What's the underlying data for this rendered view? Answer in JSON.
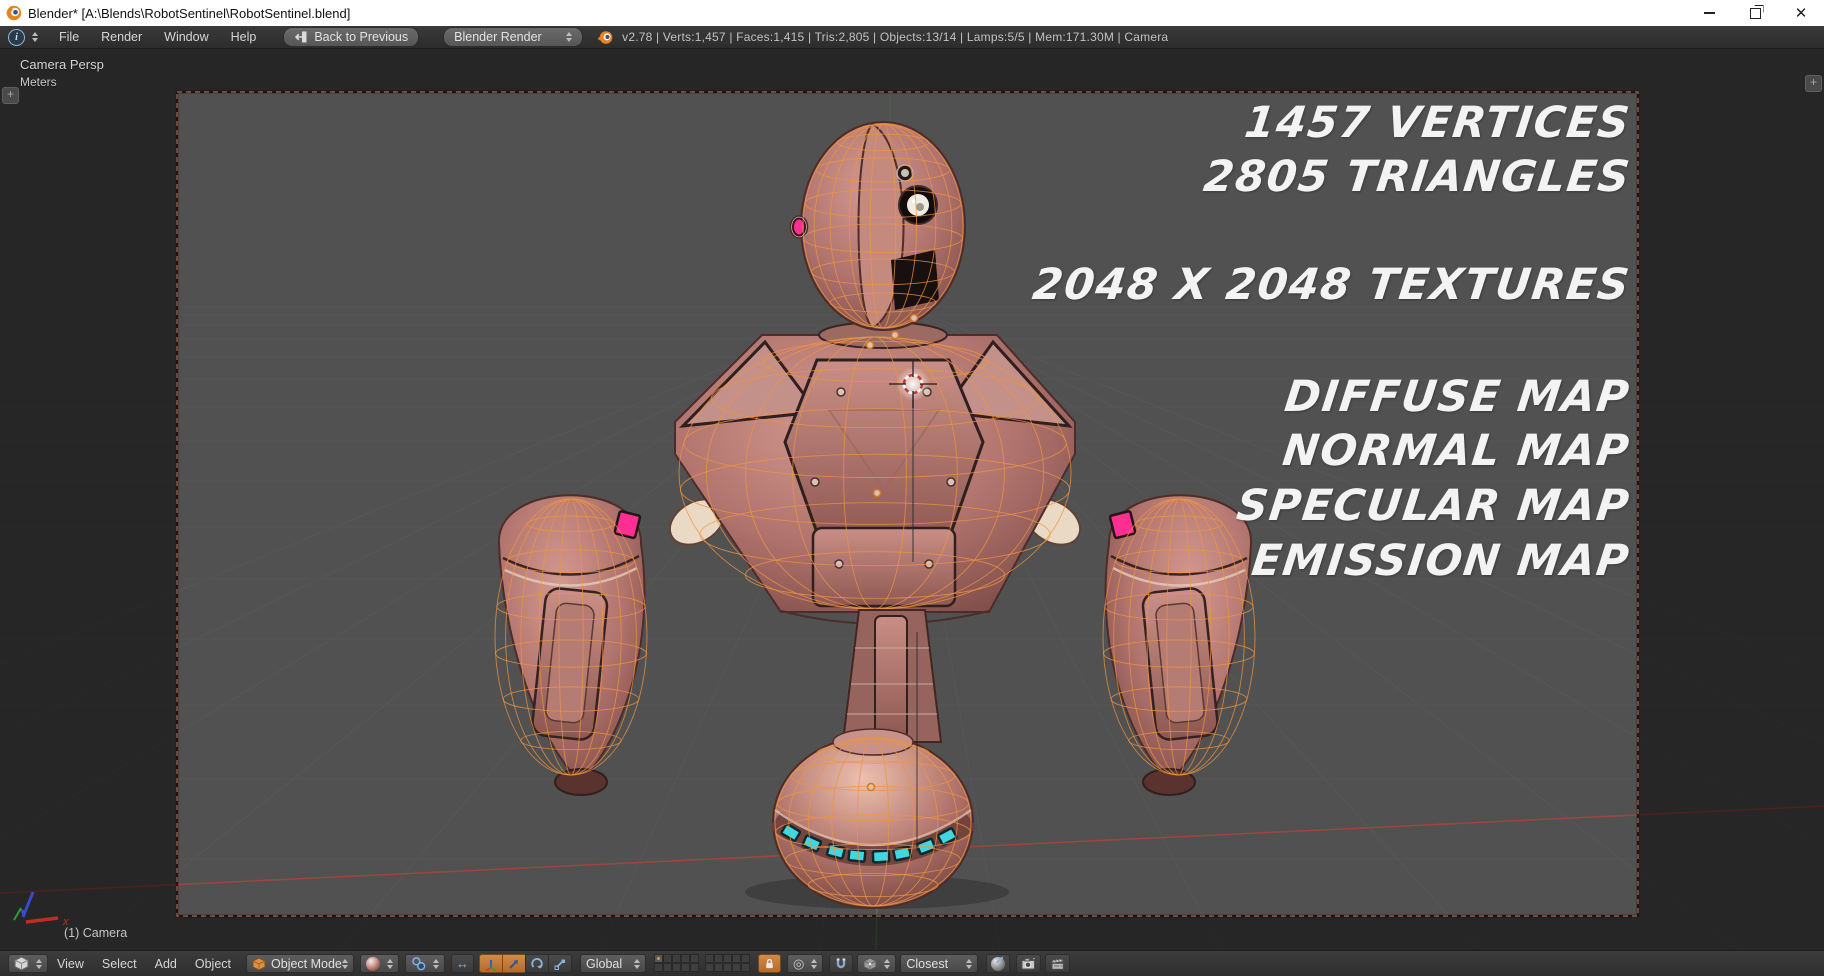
{
  "titlebar": {
    "title": "Blender* [A:\\Blends\\RobotSentinel\\RobotSentinel.blend]"
  },
  "menubar": {
    "menus": [
      {
        "label": "File"
      },
      {
        "label": "Render"
      },
      {
        "label": "Window"
      },
      {
        "label": "Help"
      }
    ],
    "back_button": "Back to Previous",
    "engine_select": "Blender Render",
    "stats": "v2.78 | Verts:1,457 | Faces:1,415 | Tris:2,805 | Objects:13/14 | Lamps:5/5 | Mem:171.30M | Camera"
  },
  "viewport": {
    "view_name": "Camera Persp",
    "units": "Meters",
    "active_camera": "(1) Camera",
    "axis_label_x": "x",
    "overlay_text": {
      "vertices": "1457 VERTICES",
      "triangles": "2805 TRIANGLES",
      "textures": "2048 X 2048 TEXTURES",
      "maps": [
        "DIFFUSE MAP",
        "NORMAL MAP",
        "SPECULAR MAP",
        "EMISSION MAP"
      ]
    }
  },
  "toolbar": {
    "menus": [
      {
        "label": "View"
      },
      {
        "label": "Select"
      },
      {
        "label": "Add"
      },
      {
        "label": "Object"
      }
    ],
    "mode_select": "Object Mode",
    "orientation_select": "Global",
    "snap_target_select": "Closest"
  },
  "icons": {
    "blender-logo": "orange spinning-top logo",
    "info-icon": "i in circle",
    "back-icon": "return arrow",
    "editor-type-icon": "cube",
    "mode-cube-icon": "orange cube",
    "shading-sphere-icon": "shaded sphere",
    "pivot-point-icon": "two circles",
    "manipulator-icon": "rgb axis cross",
    "translate-icon": "arrow",
    "rotate-icon": "arc",
    "scale-icon": "diagonal with square",
    "proportional-edit-icon": "circled dot",
    "snap-magnet-icon": "magnet",
    "snap-element-icon": "cube",
    "opengl-render-icon": "sphere with pen",
    "render-image-icon": "camera",
    "render-animation-icon": "clapperboard"
  },
  "colors": {
    "accent_orange": "#ef9440",
    "body_salmon": "#b0736d",
    "light_cyan": "#3fd8e2",
    "light_pink": "#ff2f92",
    "camera_frame_dash": "#a56a5a"
  }
}
